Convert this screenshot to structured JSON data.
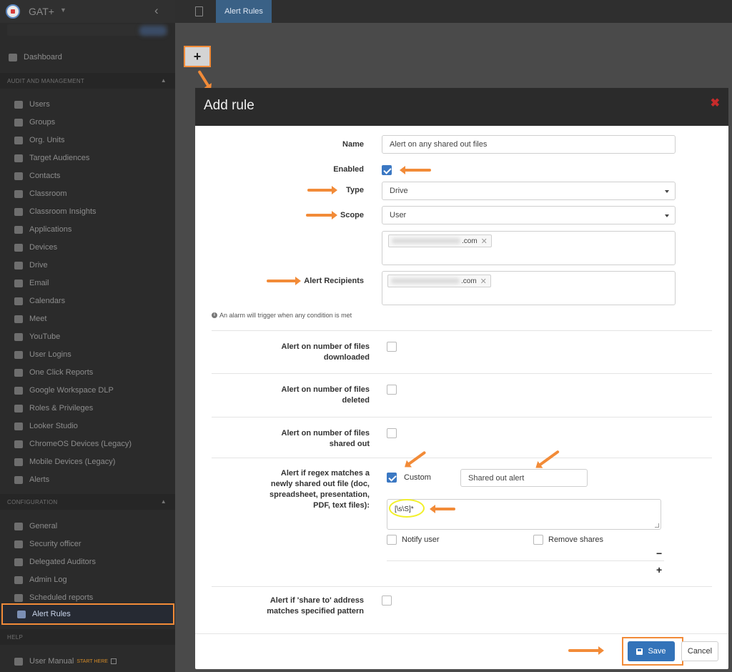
{
  "app": {
    "name": "GAT+"
  },
  "sidebar": {
    "top_items": [
      {
        "label": "Dashboard",
        "icon": "home-icon"
      }
    ],
    "sections": [
      {
        "title": "AUDIT AND MANAGEMENT",
        "items": [
          {
            "label": "Users",
            "icon": "user-icon"
          },
          {
            "label": "Groups",
            "icon": "groups-icon"
          },
          {
            "label": "Org. Units",
            "icon": "sitemap-icon"
          },
          {
            "label": "Target Audiences",
            "icon": "sitemap-icon"
          },
          {
            "label": "Contacts",
            "icon": "contacts-icon"
          },
          {
            "label": "Classroom",
            "icon": "graduation-cap-icon"
          },
          {
            "label": "Classroom Insights",
            "icon": "graduation-cap-icon"
          },
          {
            "label": "Applications",
            "icon": "grid-icon"
          },
          {
            "label": "Devices",
            "icon": "device-icon"
          },
          {
            "label": "Drive",
            "icon": "drive-icon"
          },
          {
            "label": "Email",
            "icon": "envelope-icon"
          },
          {
            "label": "Calendars",
            "icon": "calendar-icon"
          },
          {
            "label": "Meet",
            "icon": "video-icon"
          },
          {
            "label": "YouTube",
            "icon": "film-icon"
          },
          {
            "label": "User Logins",
            "icon": "globe-icon"
          },
          {
            "label": "One Click Reports",
            "icon": "eye-icon"
          },
          {
            "label": "Google Workspace DLP",
            "icon": "flask-icon"
          },
          {
            "label": "Roles & Privileges",
            "icon": "lock-icon"
          },
          {
            "label": "Looker Studio",
            "icon": "chart-icon"
          },
          {
            "label": "ChromeOS Devices (Legacy)",
            "icon": "laptop-icon"
          },
          {
            "label": "Mobile Devices (Legacy)",
            "icon": "mobile-icon"
          },
          {
            "label": "Alerts",
            "icon": "bell-icon"
          }
        ]
      },
      {
        "title": "CONFIGURATION",
        "items": [
          {
            "label": "General",
            "icon": "cogs-icon"
          },
          {
            "label": "Security officer",
            "icon": "user-shield-icon"
          },
          {
            "label": "Delegated Auditors",
            "icon": "users-icon"
          },
          {
            "label": "Admin Log",
            "icon": "user-cog-icon"
          },
          {
            "label": "Scheduled reports",
            "icon": "calendar-icon"
          },
          {
            "label": "Alert Rules",
            "icon": "list-icon"
          }
        ]
      },
      {
        "title": "HELP",
        "items": [
          {
            "label": "User Manual",
            "icon": "book-icon",
            "badge": "START HERE"
          }
        ]
      }
    ]
  },
  "topbar": {
    "active_tab": "Alert Rules"
  },
  "modal": {
    "title": "Add rule",
    "fields": {
      "name_label": "Name",
      "name_value": "Alert on any shared out files",
      "enabled_label": "Enabled",
      "type_label": "Type",
      "type_value": "Drive",
      "scope_label": "Scope",
      "scope_value": "User",
      "scope_tag_suffix": ".com",
      "recipients_label": "Alert Recipients",
      "recipients_tag_suffix": ".com"
    },
    "hint": "An alarm will trigger when any condition is met",
    "conditions": {
      "downloaded": "Alert on number of files downloaded",
      "deleted": "Alert on number of files deleted",
      "shared_out": "Alert on number of files shared out",
      "regex": "Alert if regex matches a newly shared out file (doc, spreadsheet, presentation, PDF, text files):",
      "share_to": "Alert if 'share to' address matches specified pattern"
    },
    "regex": {
      "custom_label": "Custom",
      "alert_name": "Shared out alert",
      "pattern": "[\\s\\S]*",
      "notify_user": "Notify user",
      "remove_shares": "Remove shares",
      "minus": "−",
      "plus": "+"
    },
    "footer": {
      "save": "Save",
      "cancel": "Cancel"
    }
  },
  "colors": {
    "accent": "#3373b9",
    "annotation": "#f28b38",
    "highlight": "#f2f02a",
    "close": "#c62b2b"
  }
}
